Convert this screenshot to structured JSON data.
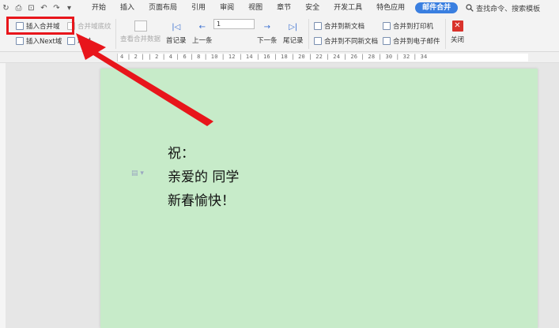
{
  "quick_access": [
    "↻",
    "⎙",
    "🔍",
    "↶",
    "↷",
    "▾"
  ],
  "menu": {
    "items": [
      "开始",
      "插入",
      "页面布局",
      "引用",
      "审阅",
      "视图",
      "章节",
      "安全",
      "开发工具",
      "特色应用"
    ],
    "active": "邮件合并",
    "search": "查找命令、搜索模板"
  },
  "ribbon": {
    "insert_merge_field": "插入合并域",
    "merge_field_shading": "合并域底纹",
    "insert_next_field": "插入Next域",
    "hidden_label": "域时",
    "view_merge_data": "查看合并数据",
    "first_record": "首记录",
    "prev_record": "上一条",
    "record_value": "1",
    "next_record": "下一条",
    "last_record": "尾记录",
    "merge_to_new_doc": "合并到新文档",
    "merge_to_diff_docs": "合并到不同新文档",
    "merge_to_printer": "合并到打印机",
    "merge_to_email": "合并到电子邮件",
    "close": "关闭"
  },
  "ruler": {
    "labels": "4 | 2 |  | 2 | 4 | 6 | 8 | 10 | 12 | 14 | 16 | 18 | 20 | 22 | 24 | 26 | 28 | 30 | 32 | 34"
  },
  "document": {
    "line1": "祝：",
    "line2": "亲爱的      同学",
    "line3": "新春愉快！"
  },
  "colors": {
    "accent": "#3a7fe0",
    "highlight_box": "#e8151b",
    "arrow": "#e8151b",
    "page_bg": "#c7ebc9"
  }
}
